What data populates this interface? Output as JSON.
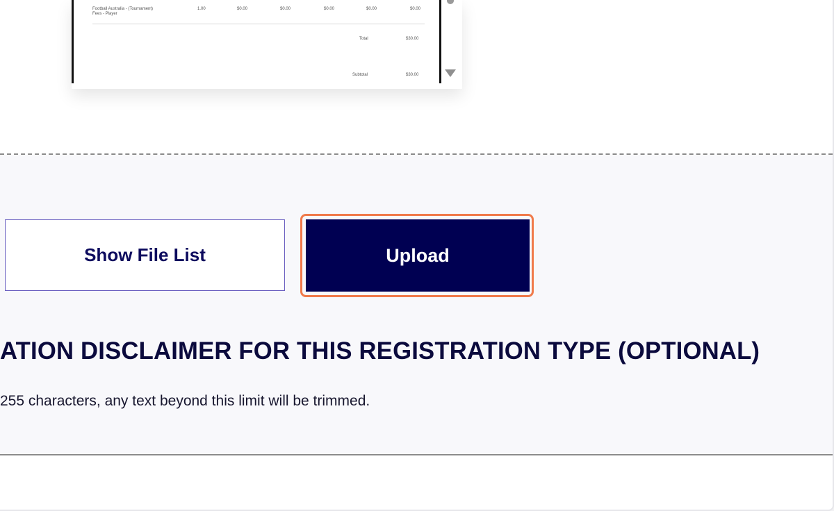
{
  "invoice_preview": {
    "line_item": {
      "description_line1": "Football Australia - (Tournament)",
      "description_line2": "Fees - Player",
      "qty": "1.00",
      "col1": "$0.00",
      "col2": "$0.00",
      "col3": "$0.00",
      "col4": "$0.00",
      "col5": "$0.00"
    },
    "total_label": "Total",
    "total_value": "$30.00",
    "subtotal_label": "Subtotal",
    "subtotal_value": "$30.00"
  },
  "buttons": {
    "show_file_list": "Show File List",
    "upload": "Upload"
  },
  "section": {
    "heading": "ATION DISCLAIMER FOR THIS REGISTRATION TYPE (OPTIONAL)",
    "note": "255 characters, any text beyond this limit will be trimmed."
  },
  "colors": {
    "primary": "#000052",
    "focus_ring": "#f07a4a",
    "outline_border": "#6a5fc0",
    "heading_text": "#0b0a3d"
  }
}
